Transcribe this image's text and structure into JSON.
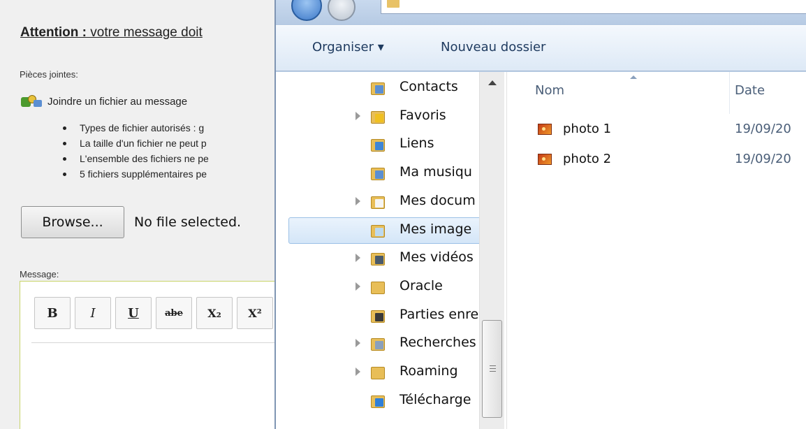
{
  "webform": {
    "attention_bold": "Attention :",
    "attention_rest": " votre message doit",
    "attachments_label": "Pièces jointes:",
    "attach_link": "Joindre un fichier au message",
    "rules": [
      "Types de fichier autorisés : g",
      "La taille d'un fichier ne peut p",
      "L'ensemble des fichiers ne pe",
      "5 fichiers supplémentaires pe"
    ],
    "browse_button": "Browse...",
    "no_file_text": "No file selected.",
    "message_label": "Message:",
    "toolbar": {
      "bold": "B",
      "italic": "I",
      "underline": "U",
      "strike": "abe",
      "subscript": "X₂",
      "superscript": "X²"
    }
  },
  "explorer": {
    "command_bar": {
      "organise": "Organiser ▾",
      "new_folder": "Nouveau dossier"
    },
    "nav_items": [
      {
        "label": "Contacts",
        "icon": "contacts-icon",
        "color": "#5b8fd2",
        "expander": false,
        "selected": false
      },
      {
        "label": "Favoris",
        "icon": "favorites-icon",
        "color": "#f0c020",
        "expander": true,
        "selected": false
      },
      {
        "label": "Liens",
        "icon": "links-icon",
        "color": "#3f86d6",
        "expander": false,
        "selected": false
      },
      {
        "label": "Ma musiqu",
        "icon": "music-folder-icon",
        "color": "#5b8fd2",
        "expander": false,
        "selected": false
      },
      {
        "label": "Mes docum",
        "icon": "documents-icon",
        "color": "#f5f5f5",
        "expander": true,
        "selected": false
      },
      {
        "label": "Mes image",
        "icon": "pictures-icon",
        "color": "#bcd9ee",
        "expander": false,
        "selected": true
      },
      {
        "label": "Mes vidéos",
        "icon": "videos-icon",
        "color": "#4a5a6a",
        "expander": true,
        "selected": false
      },
      {
        "label": "Oracle",
        "icon": "folder-icon",
        "color": "#e8be58",
        "expander": true,
        "selected": false
      },
      {
        "label": "Parties enre",
        "icon": "saved-games-icon",
        "color": "#3a3a3a",
        "expander": false,
        "selected": false
      },
      {
        "label": "Recherches",
        "icon": "searches-icon",
        "color": "#8aa0bc",
        "expander": true,
        "selected": false
      },
      {
        "label": "Roaming",
        "icon": "folder-icon",
        "color": "#e8be58",
        "expander": true,
        "selected": false
      },
      {
        "label": "Télécharge",
        "icon": "downloads-icon",
        "color": "#2f7fd8",
        "expander": false,
        "selected": false
      }
    ],
    "columns": {
      "name": "Nom",
      "date": "Date"
    },
    "files": [
      {
        "name": "photo 1",
        "date": "19/09/20"
      },
      {
        "name": "photo 2",
        "date": "19/09/20"
      }
    ]
  }
}
